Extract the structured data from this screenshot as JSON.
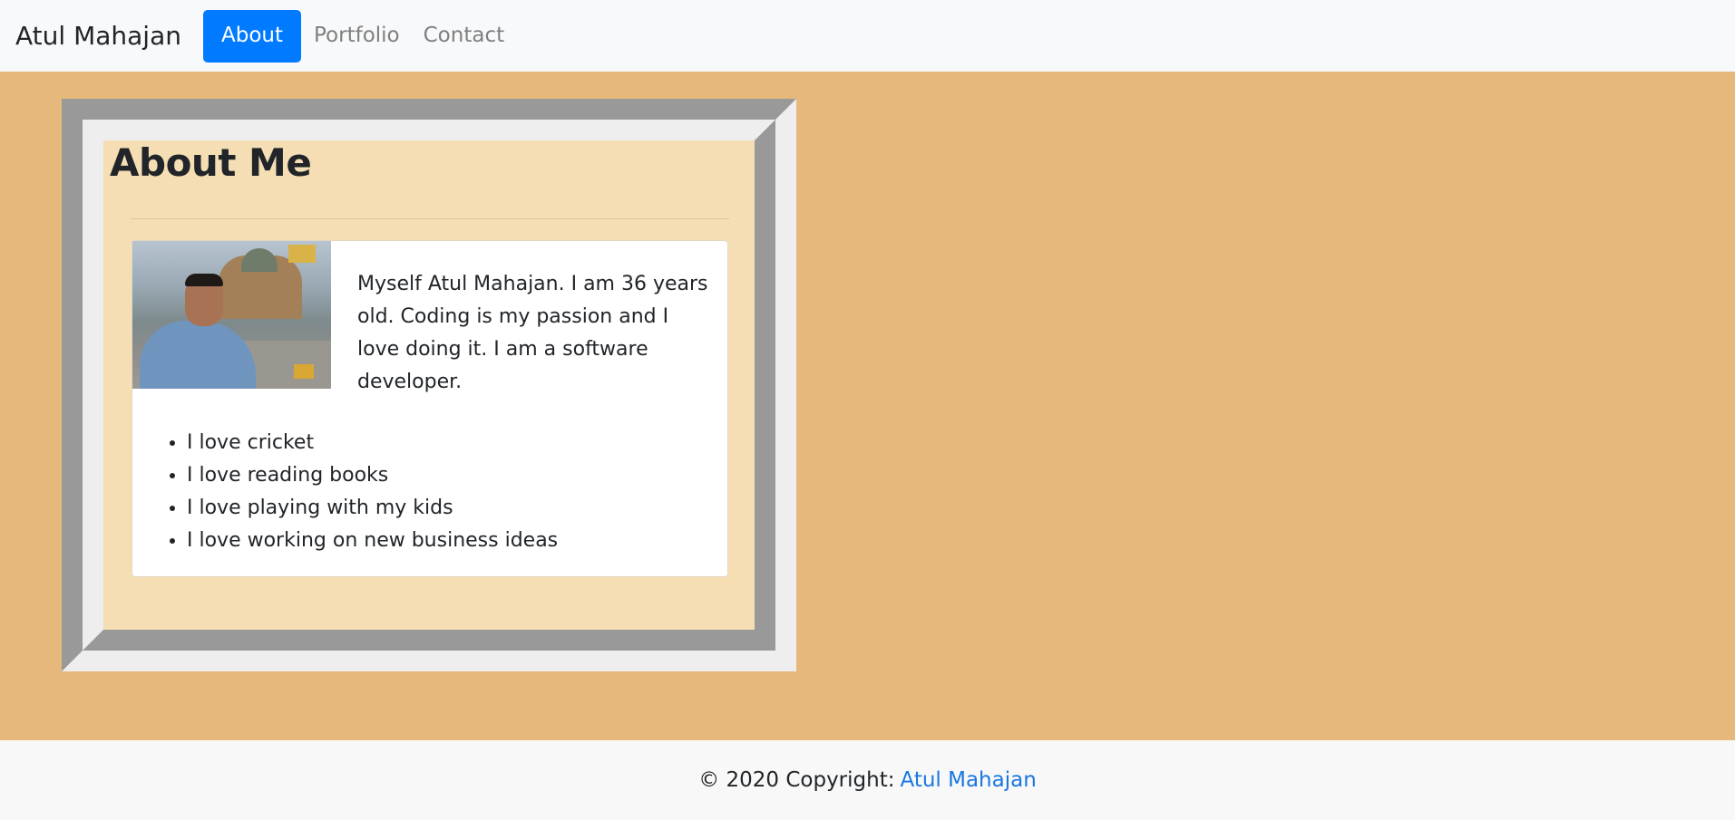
{
  "navbar": {
    "brand": "Atul Mahajan",
    "links": [
      {
        "label": "About",
        "active": true
      },
      {
        "label": "Portfolio",
        "active": false
      },
      {
        "label": "Contact",
        "active": false
      }
    ]
  },
  "about": {
    "heading": "About Me",
    "bio": "Myself Atul Mahajan. I am 36 years old. Coding is my passion and I love doing it. I am a software developer.",
    "likes": [
      "I love cricket",
      "I love reading books",
      "I love playing with my kids",
      "I love working on new business ideas"
    ]
  },
  "footer": {
    "text": "© 2020 Copyright:",
    "link": "Atul Mahajan"
  },
  "colors": {
    "accent": "#007bff",
    "background": "#e7b87b",
    "panel": "#f5deb3"
  }
}
